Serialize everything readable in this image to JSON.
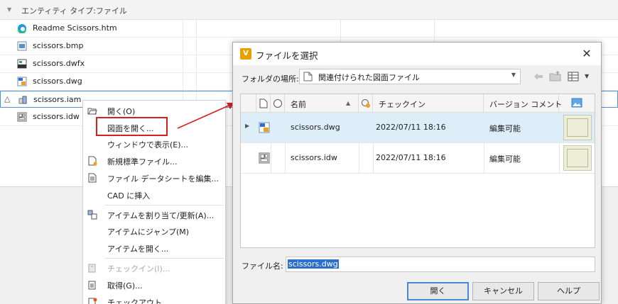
{
  "background": {
    "group_header": "エンティティ タイプ:ファイル",
    "files": [
      {
        "name": "Readme Scissors.htm",
        "icon": "edge-icon"
      },
      {
        "name": "scissors.bmp",
        "icon": "image-file-icon"
      },
      {
        "name": "scissors.dwfx",
        "icon": "dwf-file-icon"
      },
      {
        "name": "scissors.dwg",
        "icon": "dwg-file-icon"
      },
      {
        "name": "scissors.iam",
        "icon": "assembly-file-icon"
      },
      {
        "name": "scissors.idw",
        "icon": "drawing-file-icon"
      }
    ]
  },
  "context_menu": {
    "items": [
      {
        "label": "開く(O)",
        "icon": "folder-open-icon"
      },
      {
        "label": "図面を開く...",
        "icon": ""
      },
      {
        "label": "ウィンドウで表示(E)...",
        "icon": ""
      },
      {
        "label": "新規標準ファイル...",
        "icon": "new-file-icon"
      },
      {
        "label": "ファイル データシートを編集...",
        "icon": "datasheet-icon"
      },
      {
        "label": "CAD に挿入",
        "icon": ""
      },
      {
        "label": "アイテムを割り当て/更新(A)...",
        "icon": "assign-item-icon"
      },
      {
        "label": "アイテムにジャンプ(M)",
        "icon": ""
      },
      {
        "label": "アイテムを開く...",
        "icon": ""
      },
      {
        "label": "チェックイン(I)...",
        "icon": "checkin-icon",
        "disabled": true
      },
      {
        "label": "取得(G)...",
        "icon": "get-icon"
      },
      {
        "label": "チェックアウト",
        "icon": "checkout-icon"
      }
    ]
  },
  "dialog": {
    "title": "ファイルを選択",
    "folder_label": "フォルダの場所:",
    "folder_value": "関連付けられた図面ファイル",
    "columns": [
      "名前",
      "チェックイン",
      "バージョン コメント"
    ],
    "rows": [
      {
        "name": "scissors.dwg",
        "checkin": "2022/07/11 18:16",
        "comment": "編集可能",
        "icon": "dwg-file-icon"
      },
      {
        "name": "scissors.idw",
        "checkin": "2022/07/11 18:16",
        "comment": "編集可能",
        "icon": "drawing-file-icon"
      }
    ],
    "filename_label": "ファイル名:",
    "filename_value": "scissors.dwg",
    "buttons": {
      "open": "開く",
      "cancel": "キャンセル",
      "help": "ヘルプ"
    }
  },
  "colors": {
    "accent": "#2a6fce",
    "highlight": "#d62020",
    "selected_row": "#ddeef9"
  }
}
